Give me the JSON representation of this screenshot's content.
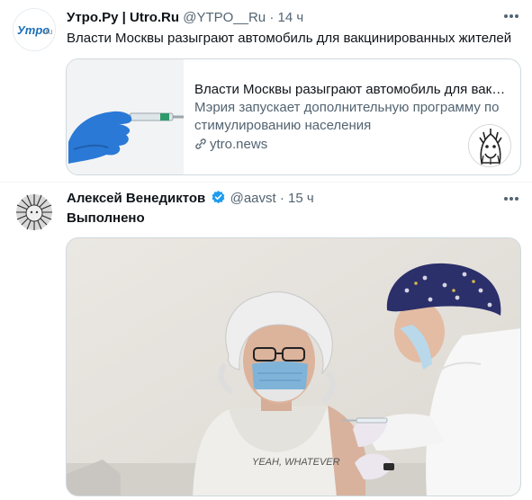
{
  "tweets": [
    {
      "author_name": "Утро.Ру | Utro.Ru",
      "handle": "@YTPO__Ru",
      "separator": "·",
      "time": "14 ч",
      "text": "Власти Москвы разыграют автомобиль для вакцинированных жителей",
      "avatar_logo_text": "Утро.ru",
      "card": {
        "title": "Власти Москвы разыграют автомобиль для вакц...",
        "description": "Мэрия запускает дополнительную программу по стимулированию населения",
        "domain": "ytro.news"
      }
    },
    {
      "author_name": "Алексей Венедиктов",
      "handle": "@aavst",
      "separator": "·",
      "time": "15 ч",
      "text": "Выполнено",
      "photo_shirt_text": "YEAH, WHATEVER"
    }
  ],
  "colors": {
    "verified": "#1d9bf0",
    "logo_blue": "#1c6fb8",
    "glove": "#2a79d6",
    "cap": "#2b2f6a"
  },
  "icons": [
    "more-icon",
    "verified-icon",
    "link-icon"
  ]
}
